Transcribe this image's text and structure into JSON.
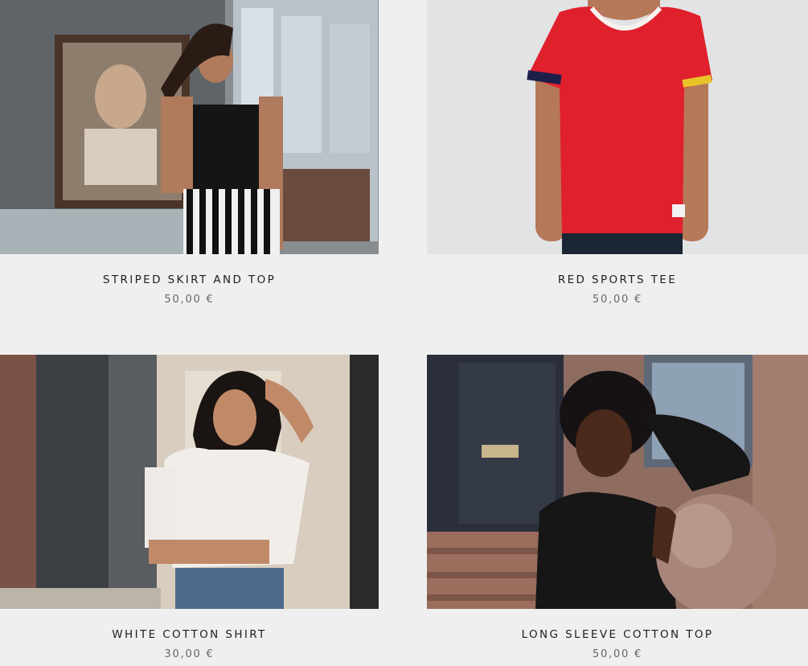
{
  "products": [
    {
      "title": "STRIPED SKIRT AND TOP",
      "price": "50,00 €",
      "image": "woman-black-top-striped-skirt-photo"
    },
    {
      "title": "RED SPORTS TEE",
      "price": "50,00 €",
      "image": "red-tshirt-torso-photo"
    },
    {
      "title": "WHITE COTTON SHIRT",
      "price": "30,00 €",
      "image": "woman-white-shirt-street-photo"
    },
    {
      "title": "LONG SLEEVE COTTON TOP",
      "price": "50,00 €",
      "image": "woman-black-longsleeve-sphere-photo"
    }
  ]
}
